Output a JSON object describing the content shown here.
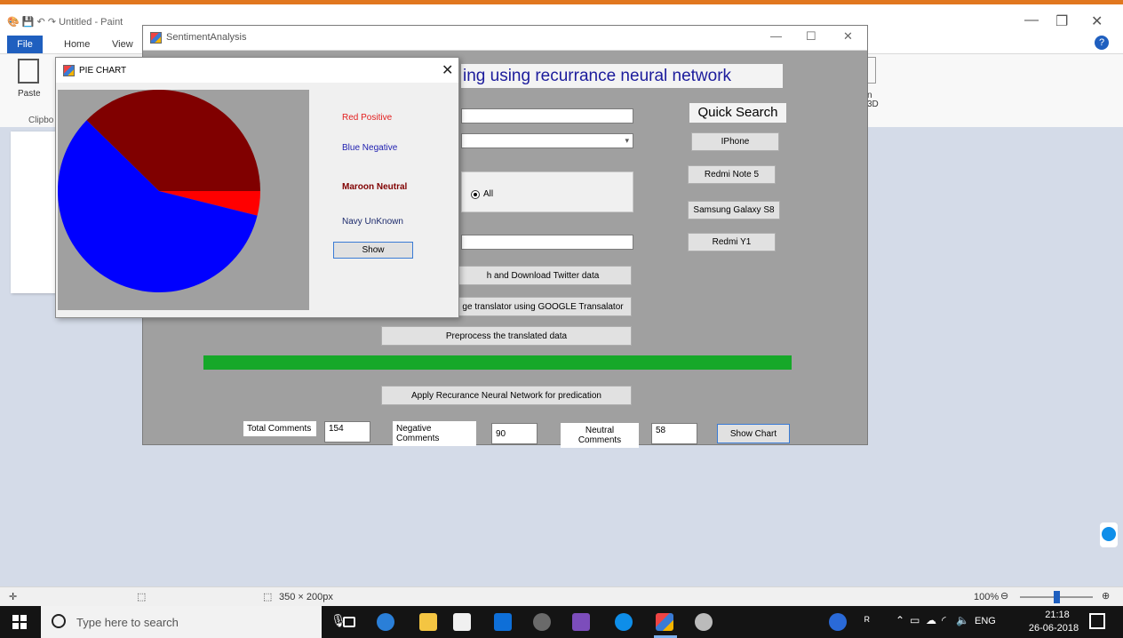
{
  "paint": {
    "window_title": "Untitled - Paint",
    "tabs": {
      "file": "File",
      "home": "Home",
      "view": "View"
    },
    "paste_label": "Paste",
    "clipboard_label": "Clipbo",
    "ribbon_fragment_1": "n",
    "ribbon_fragment_2": "3D",
    "status_dimensions": "350 × 200px",
    "zoom_level": "100%"
  },
  "sentiment": {
    "window_title": "SentimentAnalysis",
    "heading": "ing using recurrance neural network",
    "quick_search_label": "Quick Search",
    "quick_search_items": [
      "IPhone",
      "Redmi Note 5",
      "Samsung Galaxy S8",
      "Redmi Y1"
    ],
    "radio_all_label": "All",
    "buttons": {
      "download": "h and Download Twitter data",
      "translate": "ge translator using GOOGLE Transalator",
      "preprocess": "Preprocess the translated data",
      "apply_rnn": "Apply Recurance Neural Network for predication",
      "show_chart": "Show Chart"
    },
    "progress_fraction": 1.0,
    "stats": {
      "total_label": "Total Comments",
      "total_value": "154",
      "negative_label": "Negative Comments",
      "negative_value": "90",
      "neutral_label": "Neutral Comments",
      "neutral_value": "58"
    }
  },
  "pie": {
    "window_title": "PIE CHART",
    "legend": {
      "positive": "Red Positive",
      "negative": "Blue Negative",
      "neutral": "Maroon Neutral",
      "unknown": "Navy UnKnown"
    },
    "show_button": "Show"
  },
  "chart_data": {
    "type": "pie",
    "title": "",
    "slices": [
      {
        "label": "Red Positive",
        "value": 6,
        "color": "#ff0000"
      },
      {
        "label": "Blue Negative",
        "value": 90,
        "color": "#0000ff"
      },
      {
        "label": "Maroon Neutral",
        "value": 58,
        "color": "#800000"
      }
    ]
  },
  "taskbar": {
    "search_placeholder": "Type here to search",
    "language": "ENG",
    "time": "21:18",
    "date": "26-06-2018"
  },
  "colors": {
    "progress_green": "#16a829",
    "heading_blue": "#1c1c9c",
    "legend_red": "#e31e1e",
    "legend_blue": "#2020b0",
    "legend_maroon": "#800000",
    "legend_navy": "#1c2a6c"
  }
}
